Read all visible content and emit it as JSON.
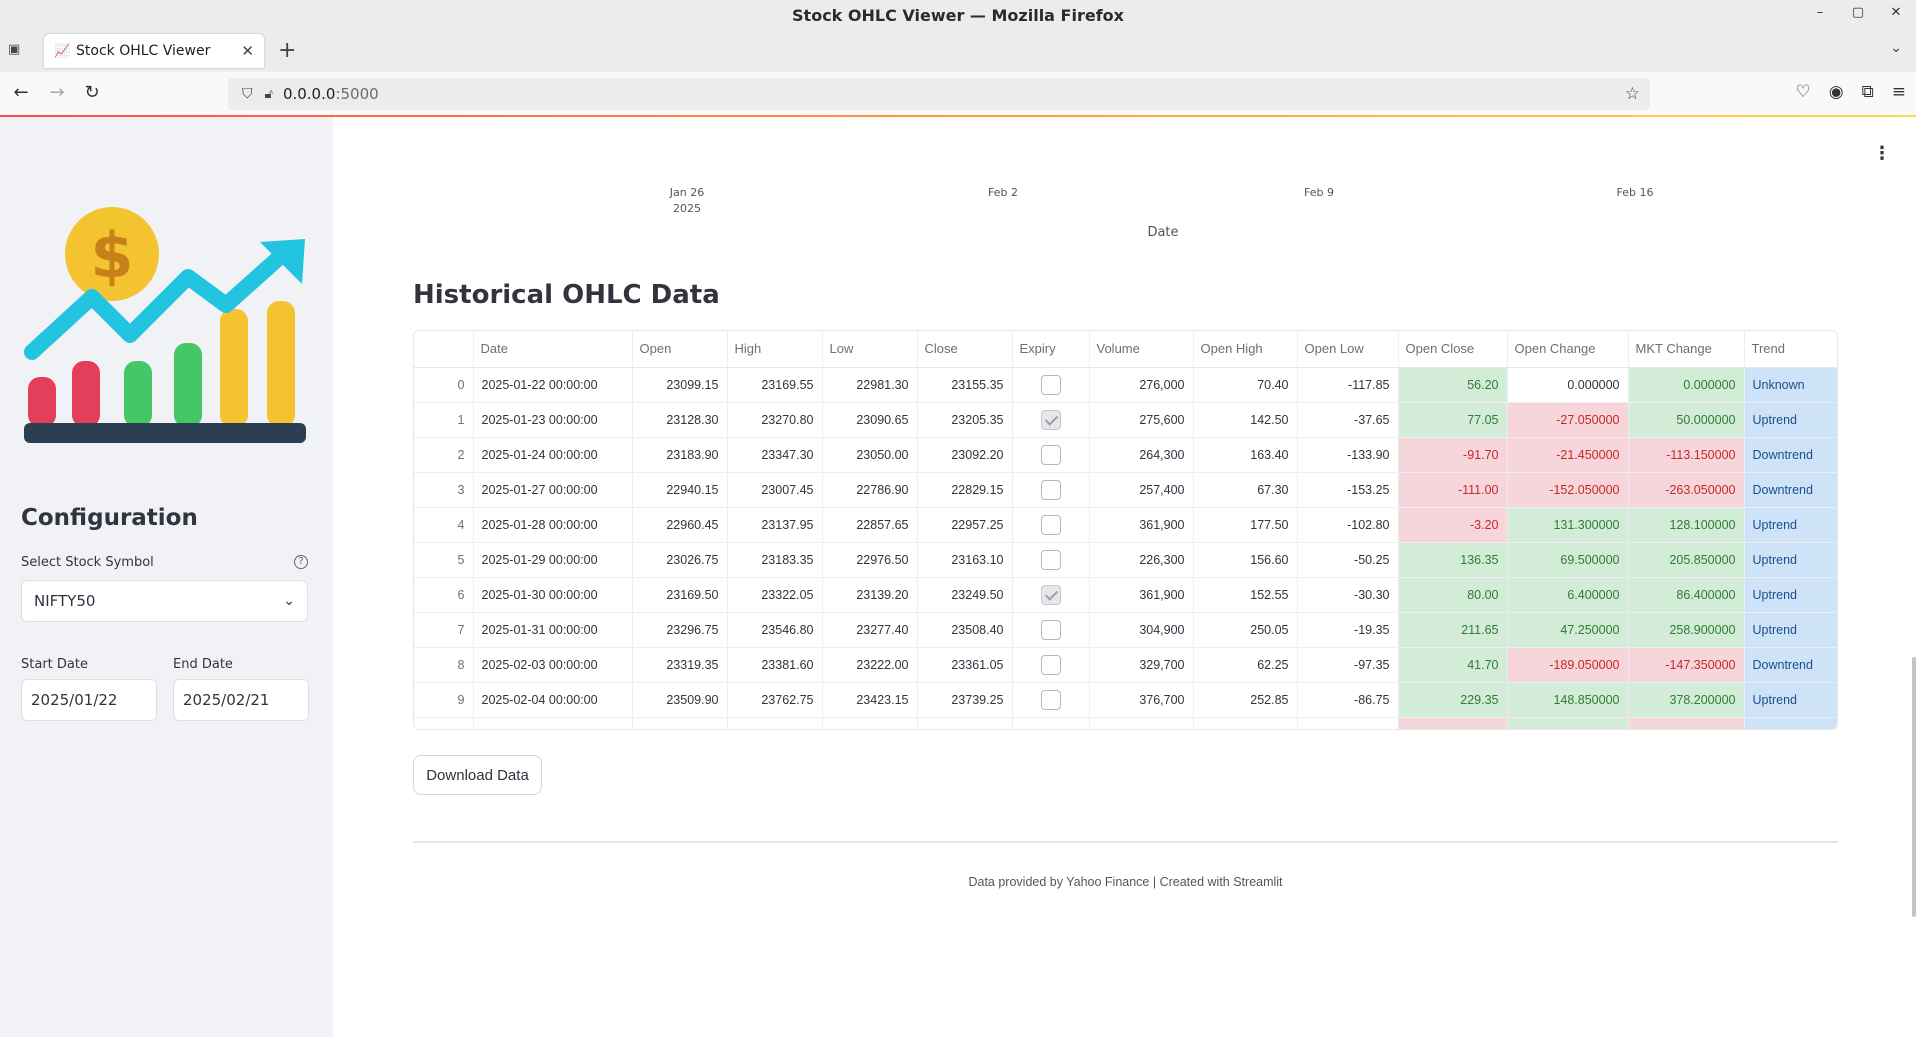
{
  "window": {
    "title": "Stock OHLC Viewer — Mozilla Firefox",
    "controls": [
      "–",
      "▢",
      "✕"
    ]
  },
  "browser": {
    "tab_title": "Stock OHLC Viewer",
    "tab_favicon": "chart-icon",
    "url_host": "0.0.0.0",
    "url_port": ":5000"
  },
  "sidebar": {
    "title": "Configuration",
    "symbol_label": "Select Stock Symbol",
    "symbol_value": "NIFTY50",
    "start_label": "Start Date",
    "start_value": "2025/01/22",
    "end_label": "End Date",
    "end_value": "2025/02/21"
  },
  "chart_axis": {
    "ticks": [
      {
        "label": "Jan 26",
        "sub": "2025"
      },
      {
        "label": "Feb 2",
        "sub": ""
      },
      {
        "label": "Feb 9",
        "sub": ""
      },
      {
        "label": "Feb 16",
        "sub": ""
      }
    ],
    "xlabel": "Date"
  },
  "main": {
    "section_title": "Historical OHLC Data",
    "download_label": "Download Data",
    "footer": "Data provided by Yahoo Finance | Created with Streamlit"
  },
  "table": {
    "columns": [
      "",
      "Date",
      "Open",
      "High",
      "Low",
      "Close",
      "Expiry",
      "Volume",
      "Open High",
      "Open Low",
      "Open Close",
      "Open Change",
      "MKT Change",
      "Trend"
    ],
    "rows": [
      {
        "idx": "0",
        "date": "2025-01-22 00:00:00",
        "open": "23099.15",
        "high": "23169.55",
        "low": "22981.30",
        "close": "23155.35",
        "expiry": false,
        "volume": "276,000",
        "open_high": "70.40",
        "open_low": "-117.85",
        "open_close": "56.20",
        "open_change": "0.000000",
        "mkt_change": "0.000000",
        "trend": "Unknown"
      },
      {
        "idx": "1",
        "date": "2025-01-23 00:00:00",
        "open": "23128.30",
        "high": "23270.80",
        "low": "23090.65",
        "close": "23205.35",
        "expiry": true,
        "volume": "275,600",
        "open_high": "142.50",
        "open_low": "-37.65",
        "open_close": "77.05",
        "open_change": "-27.050000",
        "mkt_change": "50.000000",
        "trend": "Uptrend"
      },
      {
        "idx": "2",
        "date": "2025-01-24 00:00:00",
        "open": "23183.90",
        "high": "23347.30",
        "low": "23050.00",
        "close": "23092.20",
        "expiry": false,
        "volume": "264,300",
        "open_high": "163.40",
        "open_low": "-133.90",
        "open_close": "-91.70",
        "open_change": "-21.450000",
        "mkt_change": "-113.150000",
        "trend": "Downtrend"
      },
      {
        "idx": "3",
        "date": "2025-01-27 00:00:00",
        "open": "22940.15",
        "high": "23007.45",
        "low": "22786.90",
        "close": "22829.15",
        "expiry": false,
        "volume": "257,400",
        "open_high": "67.30",
        "open_low": "-153.25",
        "open_close": "-111.00",
        "open_change": "-152.050000",
        "mkt_change": "-263.050000",
        "trend": "Downtrend"
      },
      {
        "idx": "4",
        "date": "2025-01-28 00:00:00",
        "open": "22960.45",
        "high": "23137.95",
        "low": "22857.65",
        "close": "22957.25",
        "expiry": false,
        "volume": "361,900",
        "open_high": "177.50",
        "open_low": "-102.80",
        "open_close": "-3.20",
        "open_change": "131.300000",
        "mkt_change": "128.100000",
        "trend": "Uptrend"
      },
      {
        "idx": "5",
        "date": "2025-01-29 00:00:00",
        "open": "23026.75",
        "high": "23183.35",
        "low": "22976.50",
        "close": "23163.10",
        "expiry": false,
        "volume": "226,300",
        "open_high": "156.60",
        "open_low": "-50.25",
        "open_close": "136.35",
        "open_change": "69.500000",
        "mkt_change": "205.850000",
        "trend": "Uptrend"
      },
      {
        "idx": "6",
        "date": "2025-01-30 00:00:00",
        "open": "23169.50",
        "high": "23322.05",
        "low": "23139.20",
        "close": "23249.50",
        "expiry": true,
        "volume": "361,900",
        "open_high": "152.55",
        "open_low": "-30.30",
        "open_close": "80.00",
        "open_change": "6.400000",
        "mkt_change": "86.400000",
        "trend": "Uptrend"
      },
      {
        "idx": "7",
        "date": "2025-01-31 00:00:00",
        "open": "23296.75",
        "high": "23546.80",
        "low": "23277.40",
        "close": "23508.40",
        "expiry": false,
        "volume": "304,900",
        "open_high": "250.05",
        "open_low": "-19.35",
        "open_close": "211.65",
        "open_change": "47.250000",
        "mkt_change": "258.900000",
        "trend": "Uptrend"
      },
      {
        "idx": "8",
        "date": "2025-02-03 00:00:00",
        "open": "23319.35",
        "high": "23381.60",
        "low": "23222.00",
        "close": "23361.05",
        "expiry": false,
        "volume": "329,700",
        "open_high": "62.25",
        "open_low": "-97.35",
        "open_close": "41.70",
        "open_change": "-189.050000",
        "mkt_change": "-147.350000",
        "trend": "Downtrend"
      },
      {
        "idx": "9",
        "date": "2025-02-04 00:00:00",
        "open": "23509.90",
        "high": "23762.75",
        "low": "23423.15",
        "close": "23739.25",
        "expiry": false,
        "volume": "376,700",
        "open_high": "252.85",
        "open_low": "-86.75",
        "open_close": "229.35",
        "open_change": "148.850000",
        "mkt_change": "378.200000",
        "trend": "Uptrend"
      }
    ]
  },
  "colors": {
    "positive_bg": "#d3ecd8",
    "negative_bg": "#f6d6da",
    "trend_bg": "#cfe3f8",
    "sidebar_bg": "#f0f2f6"
  }
}
